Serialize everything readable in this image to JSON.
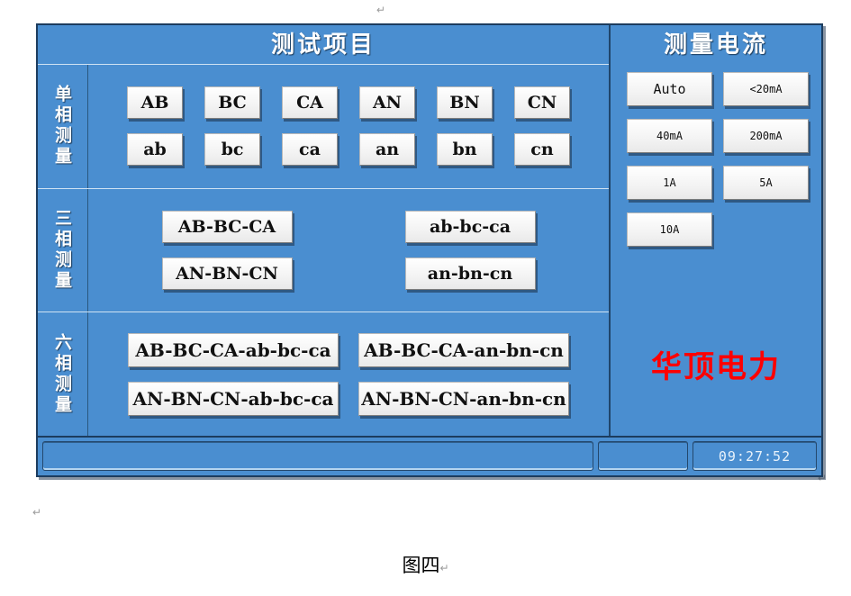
{
  "page": {
    "caption": "图四",
    "paragraph_mark": "↵"
  },
  "device": {
    "left_panel": {
      "title": "测试项目",
      "rows": [
        {
          "label": "单相测量",
          "lines": [
            [
              "AB",
              "BC",
              "CA",
              "AN",
              "BN",
              "CN"
            ],
            [
              "ab",
              "bc",
              "ca",
              "an",
              "bn",
              "cn"
            ]
          ]
        },
        {
          "label": "三相测量",
          "lines": [
            [
              "AB-BC-CA",
              "ab-bc-ca"
            ],
            [
              "AN-BN-CN",
              "an-bn-cn"
            ]
          ]
        },
        {
          "label": "六相测量",
          "lines": [
            [
              "AB-BC-CA-ab-bc-ca",
              "AB-BC-CA-an-bn-cn"
            ],
            [
              "AN-BN-CN-ab-bc-ca",
              "AN-BN-CN-an-bn-cn"
            ]
          ]
        }
      ]
    },
    "right_panel": {
      "title": "测量电流",
      "current_options": [
        "Auto",
        "<20mA",
        "40mA",
        "200mA",
        "1A",
        "5A",
        "10A"
      ],
      "brand": "华顶电力",
      "brand_color": "#ff0000"
    },
    "status_bar": {
      "message": "",
      "middle": "",
      "time": "09:27:52"
    },
    "colors": {
      "panel_background": "#4a8ed0",
      "panel_border": "#1c3c5e",
      "button_face": "#ffffff",
      "divider": "#cfe2f3"
    }
  }
}
